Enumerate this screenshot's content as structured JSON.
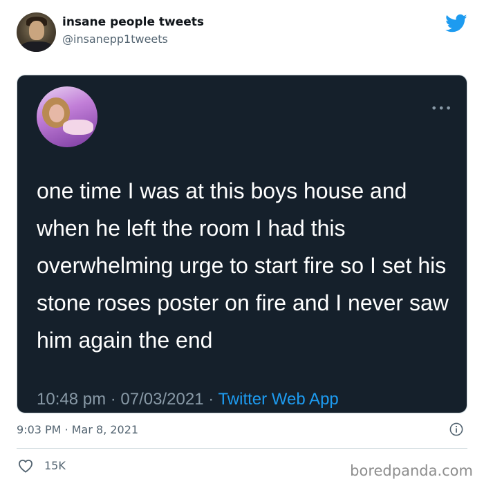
{
  "author": {
    "display_name": "insane people tweets",
    "handle": "@insanepp1tweets",
    "avatar_icon": "profile-photo"
  },
  "header": {
    "logo_icon": "twitter-bird-icon",
    "logo_color": "#1d9bf0"
  },
  "screenshot": {
    "background_color": "#15202b",
    "avatar_icon": "profile-photo",
    "more_label": "•••",
    "text": "one time I was at this boys house and when he left the room I had this overwhelming urge to start fire so I set his stone roses poster on fire and I never saw him again the end",
    "time": "10:48 pm",
    "separator": "·",
    "date": "07/03/2021",
    "source": "Twitter Web App",
    "source_color": "#1d9bf0"
  },
  "tweet": {
    "time": "9:03 PM",
    "separator": "·",
    "date": "Mar 8, 2021",
    "info_icon": "info-icon",
    "like_icon": "heart-icon",
    "likes": "15K"
  },
  "watermark": "boredpanda.com"
}
